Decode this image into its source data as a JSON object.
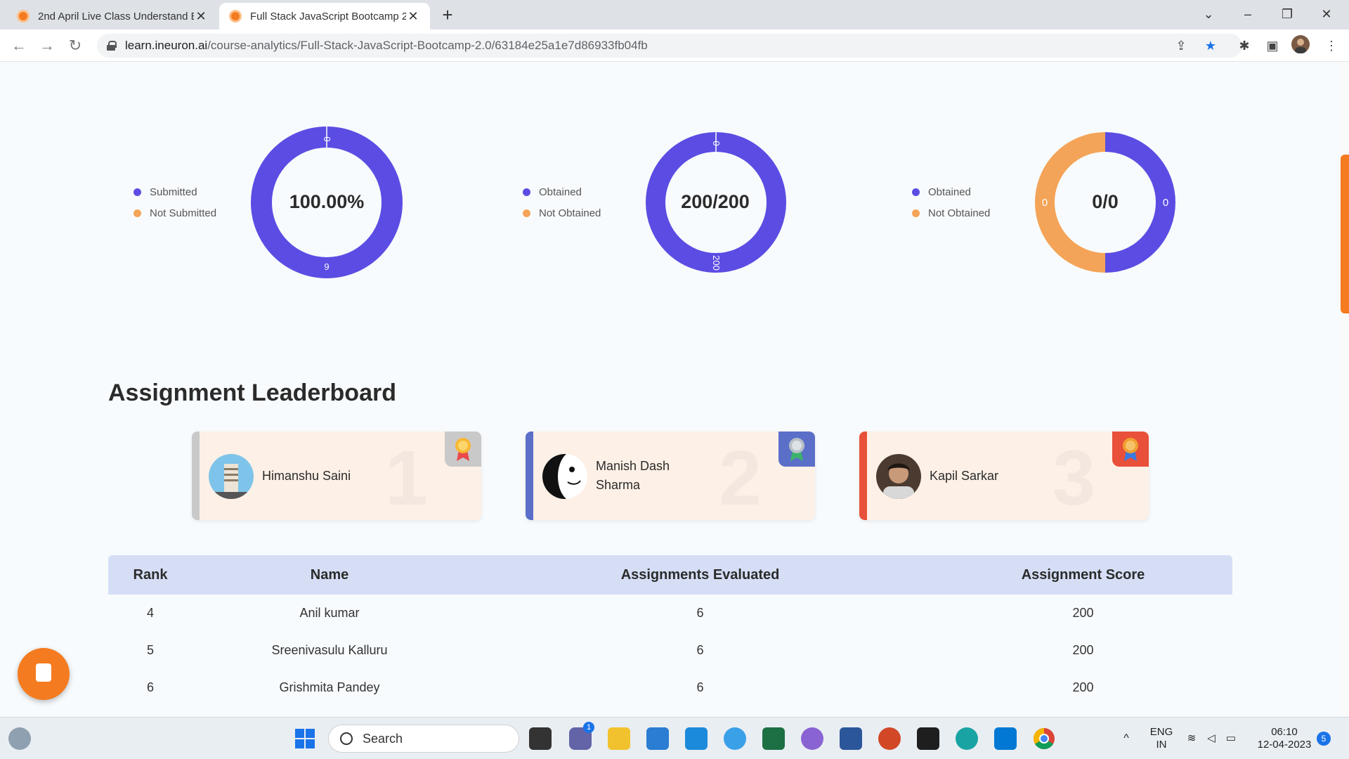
{
  "browser": {
    "tabs": [
      {
        "title": "2nd April Live Class Understand E"
      },
      {
        "title": "Full Stack JavaScript Bootcamp 2."
      }
    ],
    "url_host": "learn.ineuron.ai",
    "url_path": "/course-analytics/Full-Stack-JavaScript-Bootcamp-2.0/63184e25a1e7d86933fb04fb"
  },
  "charts": [
    {
      "center_label": "100.00%",
      "legend": [
        {
          "label": "Submitted",
          "color": "#5b4de3"
        },
        {
          "label": "Not Submitted",
          "color": "#f4a458"
        }
      ],
      "ring_labels": [
        "0",
        "6"
      ]
    },
    {
      "center_label": "200/200",
      "legend": [
        {
          "label": "Obtained",
          "color": "#5b4de3"
        },
        {
          "label": "Not Obtained",
          "color": "#f4a458"
        }
      ],
      "ring_labels": [
        "0",
        "200"
      ]
    },
    {
      "center_label": "0/0",
      "legend": [
        {
          "label": "Obtained",
          "color": "#5b4de3"
        },
        {
          "label": "Not Obtained",
          "color": "#f4a458"
        }
      ],
      "ring_labels": [
        "0",
        "0"
      ]
    }
  ],
  "chart_data": [
    {
      "type": "pie",
      "categories": [
        "Submitted",
        "Not Submitted"
      ],
      "values": [
        6,
        0
      ]
    },
    {
      "type": "pie",
      "categories": [
        "Obtained",
        "Not Obtained"
      ],
      "values": [
        200,
        0
      ]
    },
    {
      "type": "pie",
      "categories": [
        "Obtained",
        "Not Obtained"
      ],
      "values": [
        0,
        0
      ]
    }
  ],
  "leaderboard": {
    "title": "Assignment Leaderboard",
    "top": [
      {
        "rank": "1",
        "name": "Himanshu Saini",
        "stripe": "#c9c9c9",
        "medal_bg": "#c9c9c9",
        "medal_icon": "gold-medal-icon"
      },
      {
        "rank": "2",
        "name": "Manish Dash Sharma",
        "stripe": "#5b6fc9",
        "medal_bg": "#5b6fc9",
        "medal_icon": "silver-medal-icon"
      },
      {
        "rank": "3",
        "name": "Kapil Sarkar",
        "stripe": "#e8503a",
        "medal_bg": "#e8503a",
        "medal_icon": "bronze-medal-icon"
      }
    ]
  },
  "table": {
    "headers": [
      "Rank",
      "Name",
      "Assignments Evaluated",
      "Assignment Score"
    ],
    "rows": [
      [
        "4",
        "Anil kumar",
        "6",
        "200"
      ],
      [
        "5",
        "Sreenivasulu Kalluru",
        "6",
        "200"
      ],
      [
        "6",
        "Grishmita Pandey",
        "6",
        "200"
      ]
    ]
  },
  "taskbar": {
    "search_placeholder": "Search",
    "lang_top": "ENG",
    "lang_bottom": "IN",
    "time": "06:10",
    "date": "12-04-2023",
    "notif_count": "5",
    "teams_badge": "1"
  }
}
